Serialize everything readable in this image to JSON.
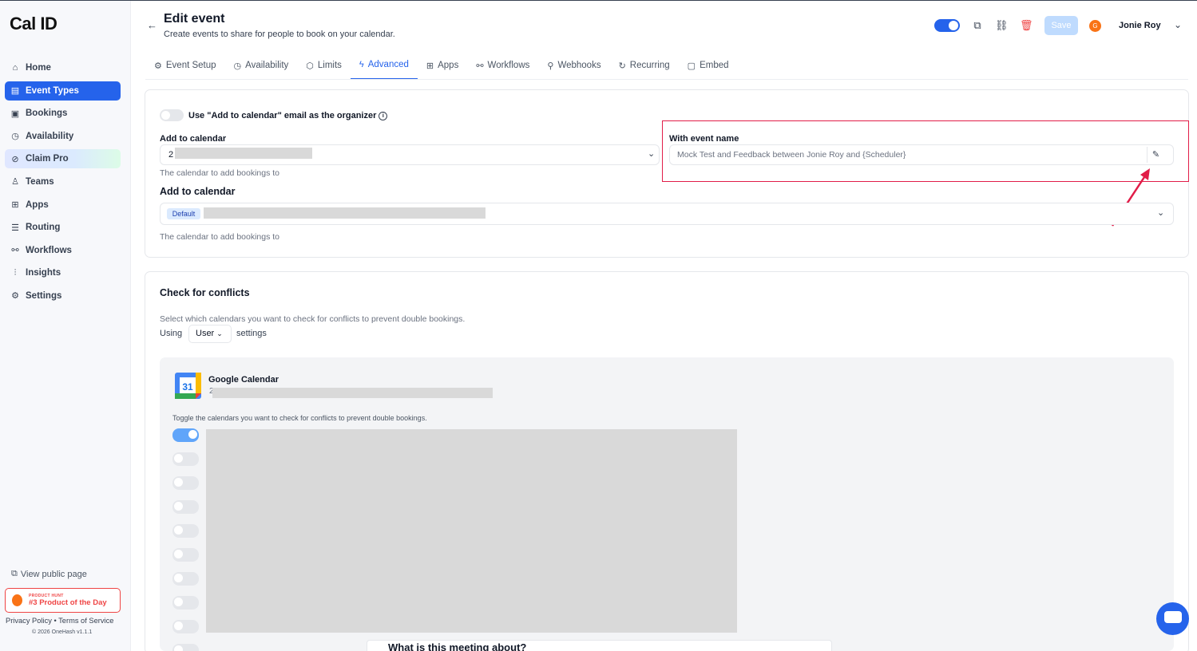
{
  "app": {
    "logo": "Cal ID"
  },
  "sidebar": {
    "items": [
      {
        "label": "Home",
        "icon": "home-icon",
        "glyph": "⌂"
      },
      {
        "label": "Event Types",
        "icon": "event-types-icon",
        "glyph": "▤"
      },
      {
        "label": "Bookings",
        "icon": "bookings-icon",
        "glyph": "▣"
      },
      {
        "label": "Availability",
        "icon": "clock-icon",
        "glyph": "◷"
      },
      {
        "label": "Claim Pro",
        "icon": "claim-pro-icon",
        "glyph": "⊘"
      },
      {
        "label": "Teams",
        "icon": "teams-icon",
        "glyph": "♙"
      },
      {
        "label": "Apps",
        "icon": "apps-icon",
        "glyph": "⊞"
      },
      {
        "label": "Routing",
        "icon": "routing-icon",
        "glyph": "☰"
      },
      {
        "label": "Workflows",
        "icon": "workflows-icon",
        "glyph": "⚯"
      },
      {
        "label": "Insights",
        "icon": "insights-icon",
        "glyph": "⫶"
      },
      {
        "label": "Settings",
        "icon": "settings-icon",
        "glyph": "⚙"
      }
    ],
    "active": "Event Types",
    "view_public": "View public page",
    "product_hunt_small": "PRODUCT HUNT",
    "product_hunt_big": "#3 Product of the Day",
    "privacy": "Privacy Policy",
    "separator": "•",
    "terms": "Terms of Service",
    "copyright": "© 2026 OneHash v1.1.1"
  },
  "header": {
    "back_glyph": "←",
    "title": "Edit event",
    "subtitle": "Create events to share for people to book on your calendar.",
    "save_label": "Save",
    "avatar_initial": "G",
    "user_name": "Jonie Roy",
    "chevron": "⌄",
    "icons": {
      "external": "⧉",
      "link": "⛓",
      "delete": "🗑"
    }
  },
  "tabs": [
    {
      "label": "Event Setup",
      "glyph": "⚙"
    },
    {
      "label": "Availability",
      "glyph": "◷"
    },
    {
      "label": "Limits",
      "glyph": "⬡"
    },
    {
      "label": "Advanced",
      "glyph": "ϟ"
    },
    {
      "label": "Apps",
      "glyph": "⊞"
    },
    {
      "label": "Workflows",
      "glyph": "⚯"
    },
    {
      "label": "Webhooks",
      "glyph": "⚲"
    },
    {
      "label": "Recurring",
      "glyph": "↻"
    },
    {
      "label": "Embed",
      "glyph": "▢"
    }
  ],
  "advanced": {
    "organizer_toggle_label": "Use \"Add to calendar\" email as the organizer",
    "organizer_toggle_on": false,
    "info_glyph": "i",
    "add_to_calendar_label": "Add to calendar",
    "add_to_calendar_value_prefix": "2",
    "add_to_calendar_hint": "The calendar to add bookings to",
    "event_name_label": "With event name",
    "event_name_value": "Mock Test and Feedback between Jonie Roy and {Scheduler}",
    "edit_glyph": "✎",
    "add_to_calendar_label_2": "Add to calendar",
    "default_tag": "Default",
    "add_to_calendar_hint_2": "The calendar to add bookings to",
    "chevron": "⌄"
  },
  "conflicts": {
    "title": "Check for conflicts",
    "description": "Select which calendars you want to check for conflicts to prevent double bookings.",
    "using_label": "Using",
    "user_select": "User",
    "settings_label": "settings",
    "gcal_title": "Google Calendar",
    "gcal_logo_number": "31",
    "gcal_account_prefix": "2",
    "toggle_hint": "Toggle the calendars you want to check for conflicts to prevent double bookings.",
    "calendar_toggles": [
      true,
      false,
      false,
      false,
      false,
      false,
      false,
      false,
      false,
      false
    ]
  },
  "overlay": {
    "meeting_question": "What is this meeting about?"
  },
  "annotation": {
    "color": "#e11d48"
  }
}
